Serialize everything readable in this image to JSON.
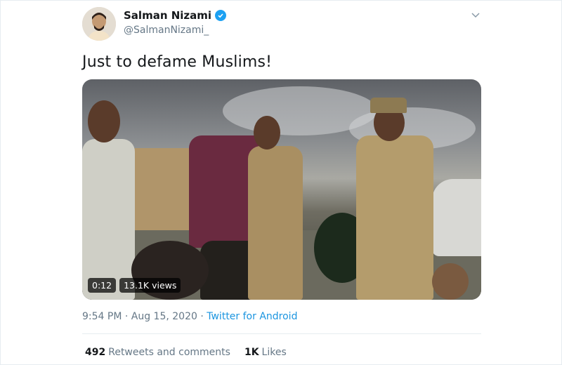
{
  "author": {
    "name": "Salman Nizami",
    "handle": "@SalmanNizami_",
    "verified": true,
    "avatar_icon": "avatar-photo"
  },
  "tweet": {
    "text": "Just to defame Muslims!",
    "timestamp": "9:54 PM · Aug 15, 2020 · ",
    "source": "Twitter for Android"
  },
  "video": {
    "duration": "0:12",
    "views": "13.1K views"
  },
  "stats": {
    "retweets_count": "492",
    "retweets_label": "Retweets and comments",
    "likes_count": "1K",
    "likes_label": "Likes"
  },
  "colors": {
    "accent": "#1da1f2",
    "link": "#1b95e0",
    "muted": "#657786",
    "text": "#14171a"
  },
  "icons": {
    "verified": "verified-badge-icon",
    "menu": "chevron-down-icon"
  }
}
